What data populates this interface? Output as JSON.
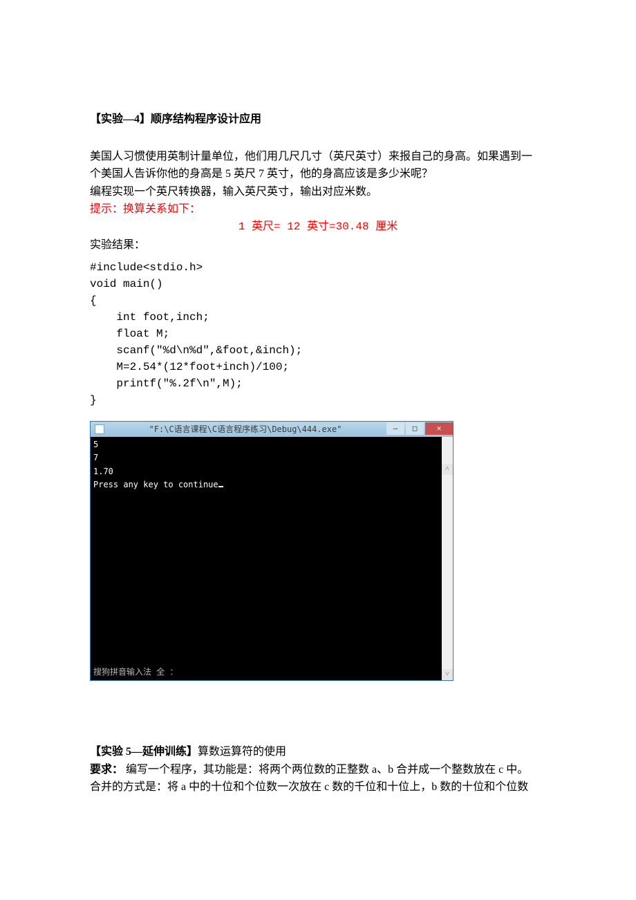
{
  "exp4": {
    "heading": "【实验—4】顺序结构程序设计应用",
    "para1": "美国人习惯使用英制计量单位，他们用几尺几寸（英尺英寸）来报自己的身高。如果遇到一",
    "para2": "个美国人告诉你他的身高是 5 英尺 7 英寸，他的身高应该是多少米呢？",
    "para3": "编程实现一个英尺转换器，输入英尺英寸，输出对应米数。",
    "hint_label": "提示：换算关系如下：",
    "formula": "1 英尺= 12 英寸=30.48 厘米",
    "result_label": "实验结果：",
    "code": "#include<stdio.h>\nvoid main()\n{\n    int foot,inch;\n    float M;\n    scanf(\"%d\\n%d\",&foot,&inch);\n    M=2.54*(12*foot+inch)/100;\n    printf(\"%.2f\\n\",M);\n}"
  },
  "console": {
    "title": "\"F:\\C语言课程\\C语言程序练习\\Debug\\444.exe\"",
    "lines": "5\n7\n1.70\nPress any key to continue",
    "ime": "搜狗拼音输入法 全 ：",
    "min": "—",
    "max": "□",
    "close": "✕",
    "up": "˄",
    "down": "˅"
  },
  "exp5": {
    "heading": "【实验 5—延伸训练】",
    "heading_rest": "算数运算符的使用",
    "req_label": "要求：",
    "req_text1": "  编写一个程序，其功能是：将两个两位数的正整数 a、b 合并成一个整数放在 c 中。",
    "req_text2": "合并的方式是：将 a 中的十位和个位数一次放在 c 数的千位和十位上，b 数的十位和个位数"
  }
}
